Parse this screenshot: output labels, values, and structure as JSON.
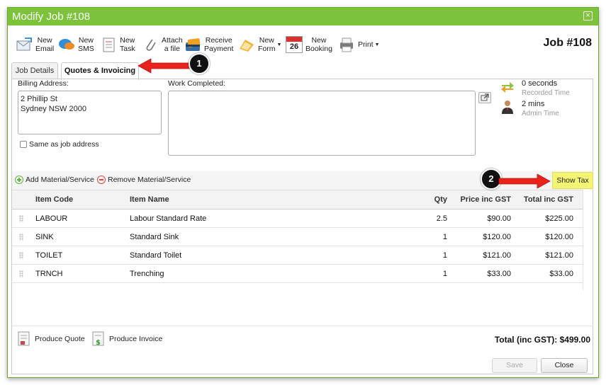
{
  "window": {
    "title": "Modify Job #108",
    "close_glyph": "×"
  },
  "toolbar": {
    "items": [
      {
        "label": "New\nEmail",
        "icon": "email-icon"
      },
      {
        "label": "New\nSMS",
        "icon": "sms-icon"
      },
      {
        "label": "New\nTask",
        "icon": "task-icon"
      },
      {
        "label": "Attach\na file",
        "icon": "paperclip-icon"
      },
      {
        "label": "Receive\nPayment",
        "icon": "credit-card-icon"
      },
      {
        "label": "New\nForm",
        "icon": "form-icon"
      },
      {
        "label": "New\nBooking",
        "icon": "calendar-icon",
        "calendar_day": "26"
      },
      {
        "label": "Print",
        "icon": "printer-icon"
      }
    ],
    "job_heading": "Job #108"
  },
  "tabs": [
    {
      "label": "Job Details",
      "active": false
    },
    {
      "label": "Quotes & Invoicing",
      "active": true
    }
  ],
  "billing": {
    "label": "Billing Address:",
    "value": "2 Phillip St\nSydney NSW 2000",
    "same_as_job_label": "Same as job address",
    "same_as_job_checked": false
  },
  "work_completed": {
    "label": "Work Completed:",
    "value": ""
  },
  "time_stats": [
    {
      "value": "0 seconds",
      "caption": "Recorded Time",
      "icon": "arrows-icon"
    },
    {
      "value": "2 mins",
      "caption": "Admin Time",
      "icon": "person-icon"
    }
  ],
  "materials": {
    "add_label": "Add Material/Service",
    "remove_label": "Remove Material/Service",
    "show_tax_label": "Show Tax"
  },
  "table": {
    "columns": [
      "Item Code",
      "Item Name",
      "Qty",
      "Price inc GST",
      "Total inc GST"
    ],
    "rows": [
      {
        "code": "LABOUR",
        "name": "Labour Standard Rate",
        "qty": "2.5",
        "price": "$90.00",
        "total": "$225.00"
      },
      {
        "code": "SINK",
        "name": "Standard Sink",
        "qty": "1",
        "price": "$120.00",
        "total": "$120.00"
      },
      {
        "code": "TOILET",
        "name": "Standard Toilet",
        "qty": "1",
        "price": "$121.00",
        "total": "$121.00"
      },
      {
        "code": "TRNCH",
        "name": "Trenching",
        "qty": "1",
        "price": "$33.00",
        "total": "$33.00"
      }
    ]
  },
  "footer": {
    "produce_quote_label": "Produce Quote",
    "produce_invoice_label": "Produce Invoice",
    "total_label": "Total (inc GST): $499.00",
    "save_label": "Save",
    "close_label": "Close"
  },
  "callouts": [
    {
      "number": "1"
    },
    {
      "number": "2"
    }
  ],
  "colors": {
    "titlebar": "#7cc23a",
    "callout_arrow": "#e8231e",
    "show_tax_bg": "#f5f574",
    "add_icon": "#5fb53c",
    "remove_icon": "#e0443a"
  }
}
